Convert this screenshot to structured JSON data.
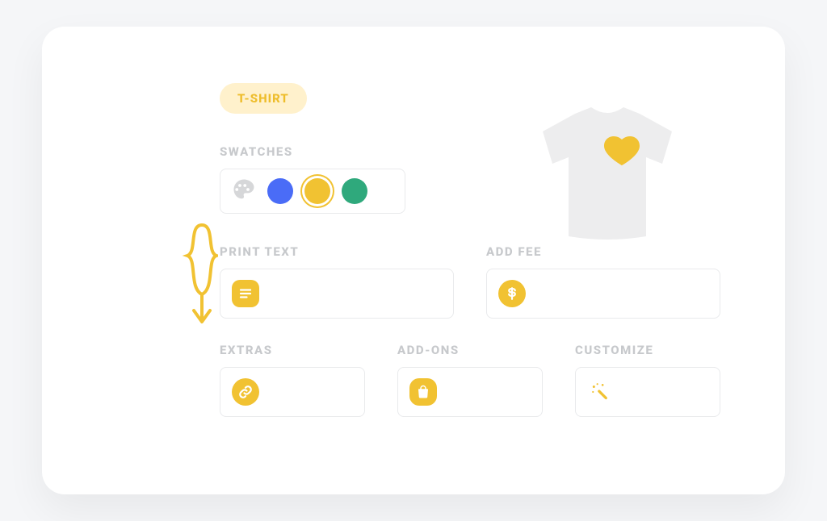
{
  "badge": "T-SHIRT",
  "swatches": {
    "label": "SWATCHES",
    "colors": [
      "#4a6cf7",
      "#f1c232",
      "#2fa97c"
    ],
    "selected_index": 1
  },
  "print_text": {
    "label": "PRINT TEXT",
    "value": ""
  },
  "add_fee": {
    "label": "ADD FEE",
    "value": ""
  },
  "extras": {
    "label": "EXTRAS",
    "value": ""
  },
  "addons": {
    "label": "ADD-ONS",
    "value": ""
  },
  "customize": {
    "label": "CUSTOMIZE",
    "value": ""
  },
  "colors": {
    "accent": "#f1c232",
    "badge_bg": "#fff1cc",
    "label": "#c7c9cc",
    "tshirt": "#ededee"
  }
}
